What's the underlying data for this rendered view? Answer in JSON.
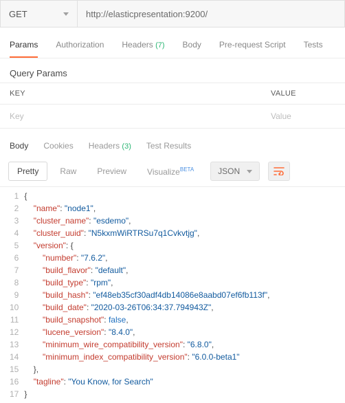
{
  "request": {
    "method": "GET",
    "url": "http://elasticpresentation:9200/"
  },
  "tabs": {
    "params": "Params",
    "authorization": "Authorization",
    "headers": "Headers",
    "headers_count": "(7)",
    "body": "Body",
    "prerequest": "Pre-request Script",
    "tests": "Tests"
  },
  "query_params": {
    "title": "Query Params",
    "key_header": "KEY",
    "value_header": "VALUE",
    "key_placeholder": "Key",
    "value_placeholder": "Value"
  },
  "response_tabs": {
    "body": "Body",
    "cookies": "Cookies",
    "headers": "Headers",
    "headers_count": "(3)",
    "test_results": "Test Results"
  },
  "viewbar": {
    "pretty": "Pretty",
    "raw": "Raw",
    "preview": "Preview",
    "visualize": "Visualize",
    "beta": "BETA",
    "format": "JSON"
  },
  "code_lines": [
    "1",
    "2",
    "3",
    "4",
    "5",
    "6",
    "7",
    "8",
    "9",
    "10",
    "11",
    "12",
    "13",
    "14",
    "15",
    "16",
    "17"
  ],
  "resp": {
    "name_k": "\"name\"",
    "name_v": "\"node1\"",
    "cluster_name_k": "\"cluster_name\"",
    "cluster_name_v": "\"esdemo\"",
    "cluster_uuid_k": "\"cluster_uuid\"",
    "cluster_uuid_v": "\"N5kxmWiRTRSu7q1Cvkvtjg\"",
    "version_k": "\"version\"",
    "number_k": "\"number\"",
    "number_v": "\"7.6.2\"",
    "build_flavor_k": "\"build_flavor\"",
    "build_flavor_v": "\"default\"",
    "build_type_k": "\"build_type\"",
    "build_type_v": "\"rpm\"",
    "build_hash_k": "\"build_hash\"",
    "build_hash_v": "\"ef48eb35cf30adf4db14086e8aabd07ef6fb113f\"",
    "build_date_k": "\"build_date\"",
    "build_date_v": "\"2020-03-26T06:34:37.794943Z\"",
    "build_snapshot_k": "\"build_snapshot\"",
    "build_snapshot_v": "false",
    "lucene_k": "\"lucene_version\"",
    "lucene_v": "\"8.4.0\"",
    "mwc_k": "\"minimum_wire_compatibility_version\"",
    "mwc_v": "\"6.8.0\"",
    "mic_k": "\"minimum_index_compatibility_version\"",
    "mic_v": "\"6.0.0-beta1\"",
    "tagline_k": "\"tagline\"",
    "tagline_v": "\"You Know, for Search\""
  }
}
